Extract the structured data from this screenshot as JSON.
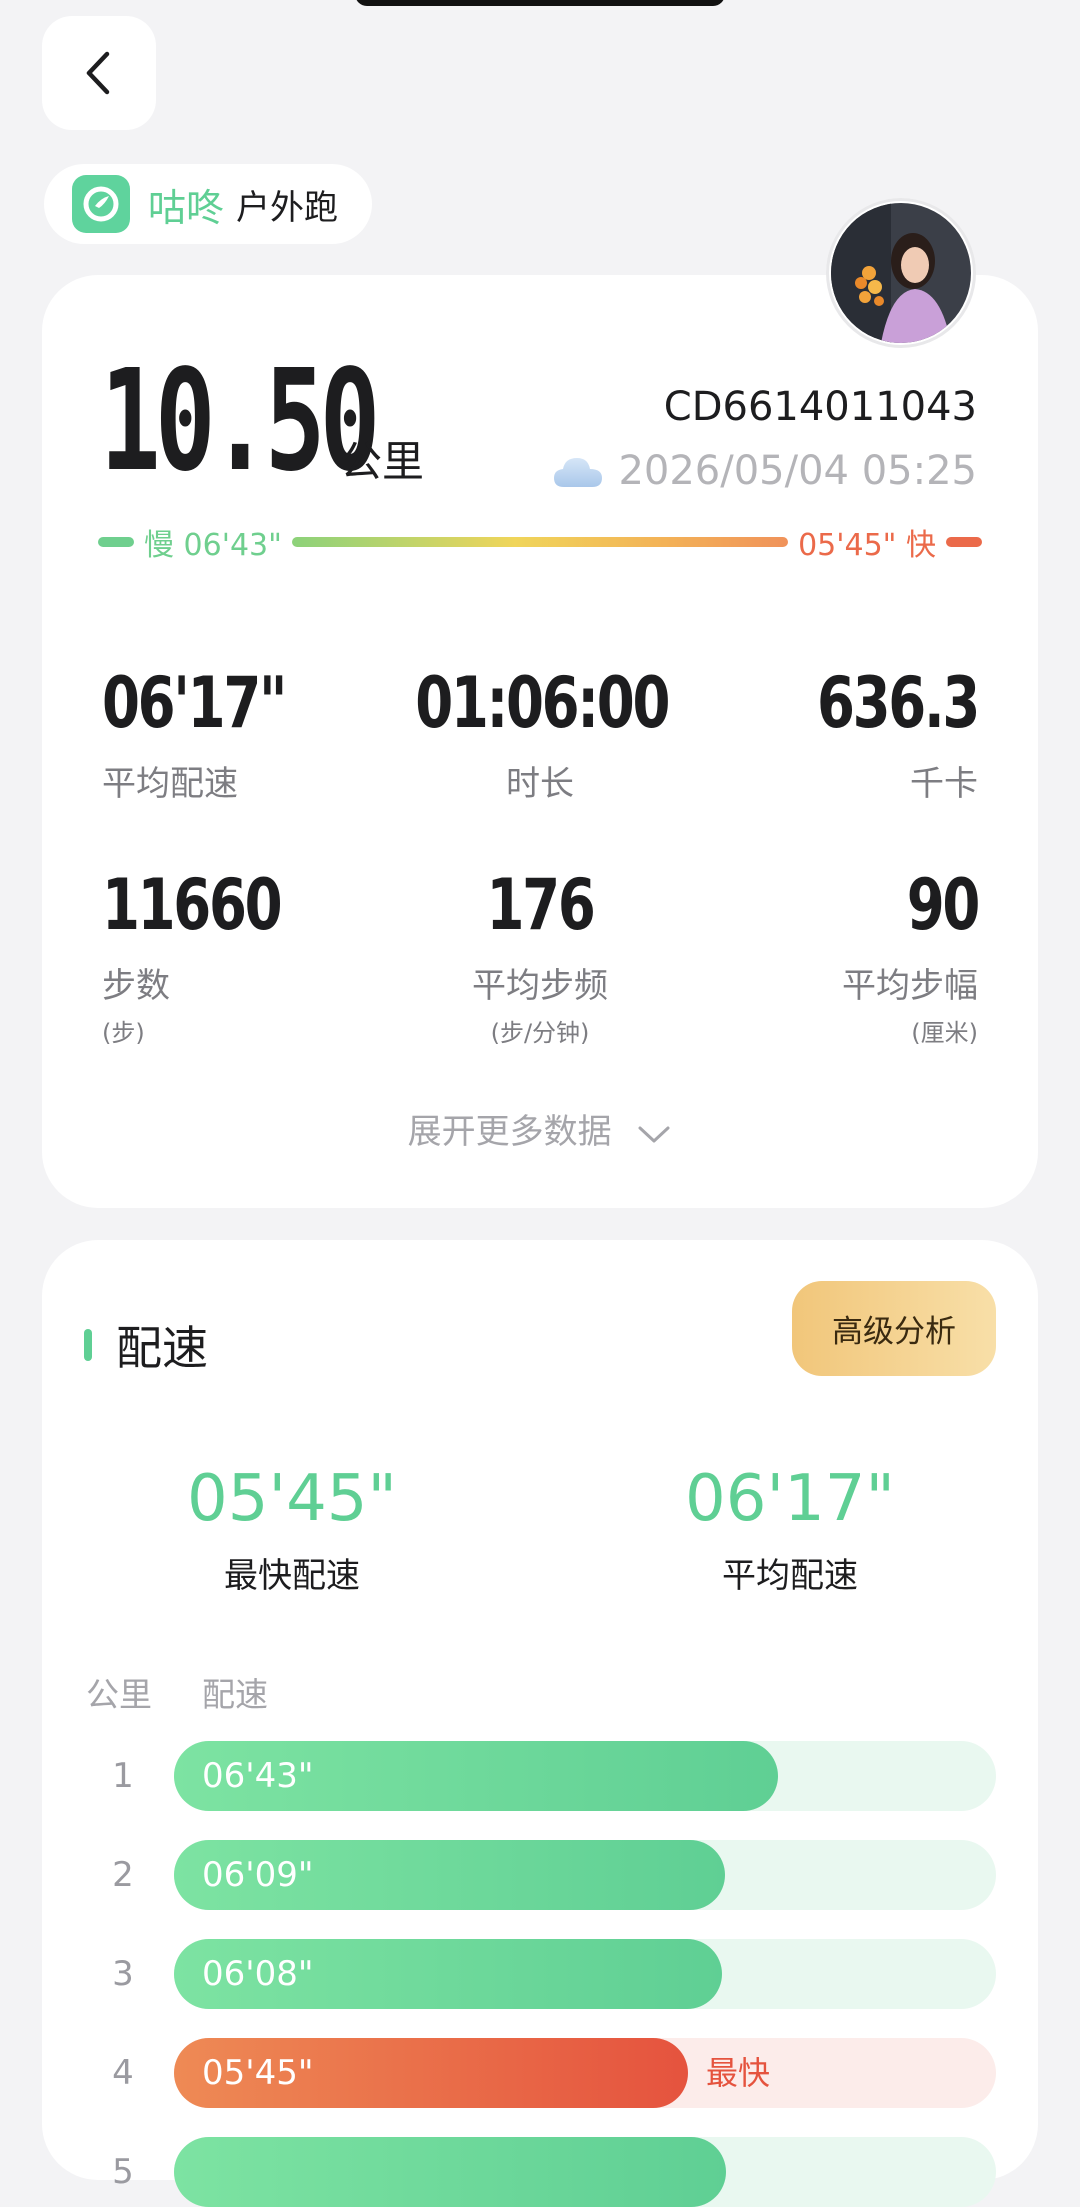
{
  "app": {
    "name": "咕咚",
    "sport_type": "户外跑"
  },
  "summary": {
    "distance": "10.50",
    "distance_unit": "公里",
    "record_id": "CD6614011043",
    "datetime": "2026/05/04 05:25",
    "weather_icon": "cloud-icon",
    "pace_scale": {
      "slow_label": "慢 06'43\"",
      "fast_label": "05'45\" 快"
    }
  },
  "stats": [
    {
      "value": "06'17\"",
      "label": "平均配速",
      "sub": ""
    },
    {
      "value": "01:06:00",
      "label": "时长",
      "sub": ""
    },
    {
      "value": "636.3",
      "label": "千卡",
      "sub": ""
    },
    {
      "value": "11660",
      "label": "步数",
      "sub": "(步)"
    },
    {
      "value": "176",
      "label": "平均步频",
      "sub": "(步/分钟)"
    },
    {
      "value": "90",
      "label": "平均步幅",
      "sub": "(厘米)"
    }
  ],
  "expand_label": "展开更多数据",
  "pace_section": {
    "title": "配速",
    "advanced_button": "高级分析",
    "fastest": {
      "value": "05'45\"",
      "label": "最快配速"
    },
    "average": {
      "value": "06'17\"",
      "label": "平均配速"
    },
    "columns": {
      "km": "公里",
      "pace": "配速"
    },
    "splits": [
      {
        "km": "1",
        "pace": "06'43\"",
        "fraction": 0.735,
        "fastest": false
      },
      {
        "km": "2",
        "pace": "06'09\"",
        "fraction": 0.67,
        "fastest": false
      },
      {
        "km": "3",
        "pace": "06'08\"",
        "fraction": 0.667,
        "fastest": false
      },
      {
        "km": "4",
        "pace": "05'45\"",
        "fraction": 0.625,
        "fastest": true
      },
      {
        "km": "5",
        "pace": "",
        "fraction": 0.672,
        "fastest": false
      }
    ],
    "fastest_tag": "最快"
  },
  "colors": {
    "accent_green": "#5fcf94",
    "fast_red": "#e5533e",
    "gold_button": "#f1c67a"
  }
}
